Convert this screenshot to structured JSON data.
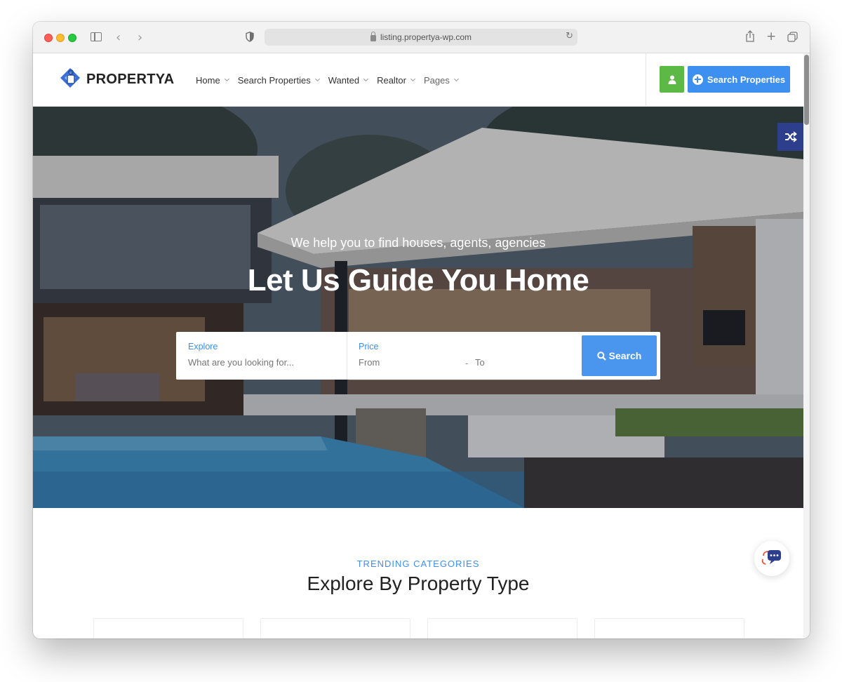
{
  "browser": {
    "url": "listing.propertya-wp.com"
  },
  "header": {
    "logo_text": "PROPERTYA",
    "nav": [
      {
        "label": "Home"
      },
      {
        "label": "Search Properties"
      },
      {
        "label": "Wanted"
      },
      {
        "label": "Realtor"
      },
      {
        "label": "Pages"
      }
    ],
    "cta_label": "Search Properties"
  },
  "hero": {
    "subtitle": "We help you to find houses, agents, agencies",
    "title": "Let Us Guide You Home",
    "search": {
      "explore_label": "Explore",
      "explore_placeholder": "What are you looking for...",
      "price_label": "Price",
      "from_placeholder": "From",
      "separator": "-",
      "to_placeholder": "To",
      "button_label": "Search"
    }
  },
  "section": {
    "kicker": "TRENDING CATEGORIES",
    "title": "Explore By Property Type"
  },
  "colors": {
    "accent": "#3d8ff0",
    "user_button": "#5db945",
    "shuffle_button": "#2d3e8c"
  },
  "icons": [
    "shield-icon",
    "lock-icon",
    "reload-icon",
    "share-icon",
    "new-tab-icon",
    "tabs-icon",
    "user-icon",
    "plus-circle-icon",
    "shuffle-icon",
    "search-icon",
    "chat-icon"
  ]
}
